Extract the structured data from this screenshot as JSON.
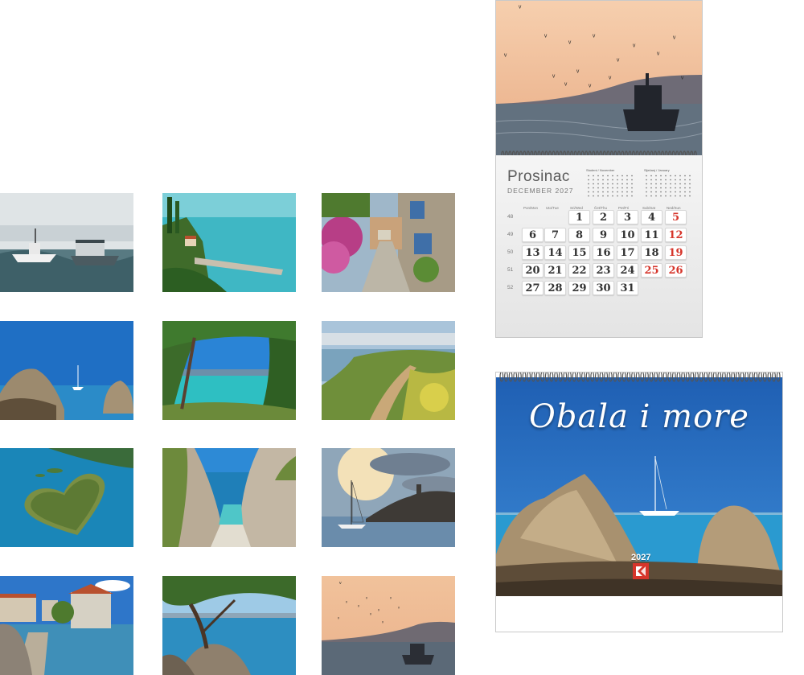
{
  "thumbnails": [
    {
      "subject": "fishing boats in morning mist"
    },
    {
      "subject": "coastal pier with cypress trees"
    },
    {
      "subject": "stone alley with pink flowers"
    },
    {
      "subject": "sailboat between rocks"
    },
    {
      "subject": "turquoise bay through pine trees"
    },
    {
      "subject": "green coastal path"
    },
    {
      "subject": "heart shaped island"
    },
    {
      "subject": "hidden beach cove"
    },
    {
      "subject": "sailboat at sunset"
    },
    {
      "subject": "stone village by the sea"
    },
    {
      "subject": "pine tree over rocky shore"
    },
    {
      "subject": "fishing boat with seagulls"
    }
  ],
  "wall_calendar": {
    "month": "Prosinac",
    "month_en": "DECEMBER 2027",
    "weekday_headers": [
      "Pon/Mon",
      "Uto/Tue",
      "Sri/Wed",
      "Čet/Thu",
      "Pet/Fri",
      "Sub/Sat",
      "Ned/Sun"
    ],
    "week_numbers": [
      "48",
      "49",
      "50",
      "51",
      "52"
    ],
    "days": [
      [
        "",
        "",
        "1",
        "2",
        "3",
        "4",
        "5"
      ],
      [
        "6",
        "7",
        "8",
        "9",
        "10",
        "11",
        "12"
      ],
      [
        "13",
        "14",
        "15",
        "16",
        "17",
        "18",
        "19"
      ],
      [
        "20",
        "21",
        "22",
        "23",
        "24",
        "25",
        "26"
      ],
      [
        "27",
        "28",
        "29",
        "30",
        "31",
        "",
        ""
      ]
    ],
    "red_days": [
      "5",
      "12",
      "19",
      "25",
      "26"
    ],
    "mini_left_title": "Studeni / November",
    "mini_right_title": "Siječanj / January"
  },
  "cover": {
    "title": "Obala i more",
    "year": "2027"
  },
  "colors": {
    "red": "#d6352b",
    "sea": "#1f7fc4",
    "sky": "#2a6fc0"
  }
}
